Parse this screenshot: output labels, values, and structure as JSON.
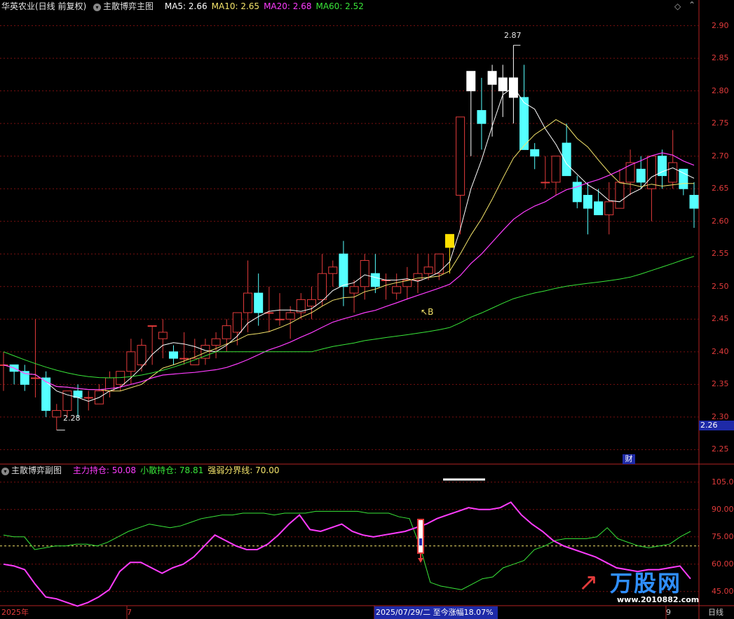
{
  "main_panel": {
    "stock_name": "华英农业(日线 前复权)",
    "indicator_name": "主散博弈主图",
    "ma": [
      {
        "label": "MA5: 2.66",
        "color": "#ffffff"
      },
      {
        "label": "MA10: 2.65",
        "color": "#f5e56b"
      },
      {
        "label": "MA20: 2.68",
        "color": "#ff3cff"
      },
      {
        "label": "MA60: 2.52",
        "color": "#39e639"
      }
    ],
    "y_ticks": [
      "2.90",
      "2.85",
      "2.80",
      "2.75",
      "2.70",
      "2.65",
      "2.60",
      "2.55",
      "2.50",
      "2.45",
      "2.40",
      "2.35",
      "2.30",
      "2.25"
    ],
    "high_label": "2.87",
    "low_label": "2.28",
    "buy_label": "B",
    "current_price": "2.26",
    "fin_badge": "财"
  },
  "sub_panel": {
    "indicator_name": "主散博弈副图",
    "legend": [
      {
        "label": "主力持仓: 50.08",
        "color": "#ff3cff"
      },
      {
        "label": "小散持仓: 78.81",
        "color": "#39e639"
      },
      {
        "label": "强弱分界线: 70.00",
        "color": "#f5e56b"
      }
    ],
    "y_ticks": [
      "105.0",
      "90.00",
      "75.00",
      "60.00",
      "45.00"
    ]
  },
  "bottom_bar": {
    "year_label": "2025年",
    "month_label": "7",
    "date_readout": "2025/07/29/二  至今涨幅18.07%",
    "right_label": "9",
    "period_label": "日线",
    "watermark": "万股网",
    "watermark_url": "www.2010882.com"
  },
  "chart_data": {
    "type": "candlestick",
    "candles": [
      [
        2.38,
        2.4,
        2.34,
        2.38
      ],
      [
        2.38,
        2.38,
        2.35,
        2.37
      ],
      [
        2.37,
        2.38,
        2.34,
        2.35
      ],
      [
        2.36,
        2.45,
        2.33,
        2.36
      ],
      [
        2.36,
        2.37,
        2.3,
        2.31
      ],
      [
        2.3,
        2.32,
        2.28,
        2.31
      ],
      [
        2.31,
        2.34,
        2.3,
        2.34
      ],
      [
        2.34,
        2.35,
        2.3,
        2.33
      ],
      [
        2.33,
        2.34,
        2.31,
        2.33
      ],
      [
        2.32,
        2.35,
        2.32,
        2.34
      ],
      [
        2.34,
        2.37,
        2.33,
        2.36
      ],
      [
        2.35,
        2.37,
        2.34,
        2.37
      ],
      [
        2.37,
        2.42,
        2.35,
        2.4
      ],
      [
        2.38,
        2.42,
        2.37,
        2.41
      ],
      [
        2.44,
        2.44,
        2.38,
        2.44
      ],
      [
        2.42,
        2.45,
        2.39,
        2.43
      ],
      [
        2.4,
        2.41,
        2.38,
        2.39
      ],
      [
        2.39,
        2.43,
        2.38,
        2.39
      ],
      [
        2.38,
        2.42,
        2.38,
        2.39
      ],
      [
        2.39,
        2.42,
        2.38,
        2.41
      ],
      [
        2.41,
        2.43,
        2.39,
        2.42
      ],
      [
        2.42,
        2.45,
        2.4,
        2.44
      ],
      [
        2.43,
        2.46,
        2.41,
        2.46
      ],
      [
        2.46,
        2.54,
        2.43,
        2.49
      ],
      [
        2.49,
        2.52,
        2.44,
        2.46
      ],
      [
        2.46,
        2.5,
        2.43,
        2.46
      ],
      [
        2.45,
        2.49,
        2.44,
        2.45
      ],
      [
        2.45,
        2.47,
        2.42,
        2.46
      ],
      [
        2.46,
        2.49,
        2.45,
        2.48
      ],
      [
        2.47,
        2.5,
        2.45,
        2.48
      ],
      [
        2.48,
        2.55,
        2.47,
        2.52
      ],
      [
        2.52,
        2.54,
        2.5,
        2.53
      ],
      [
        2.55,
        2.57,
        2.47,
        2.5
      ],
      [
        2.49,
        2.51,
        2.46,
        2.5
      ],
      [
        2.5,
        2.55,
        2.48,
        2.54
      ],
      [
        2.52,
        2.55,
        2.49,
        2.5
      ],
      [
        2.51,
        2.52,
        2.48,
        2.51
      ],
      [
        2.49,
        2.52,
        2.48,
        2.5
      ],
      [
        2.5,
        2.53,
        2.48,
        2.51
      ],
      [
        2.51,
        2.55,
        2.49,
        2.52
      ],
      [
        2.52,
        2.55,
        2.51,
        2.53
      ],
      [
        2.52,
        2.55,
        2.51,
        2.55
      ],
      [
        2.56,
        2.57,
        2.52,
        2.58
      ],
      [
        2.64,
        2.76,
        2.58,
        2.76
      ],
      [
        2.8,
        2.83,
        2.7,
        2.83
      ],
      [
        2.77,
        2.82,
        2.71,
        2.75
      ],
      [
        2.83,
        2.84,
        2.73,
        2.81
      ],
      [
        2.8,
        2.84,
        2.76,
        2.82
      ],
      [
        2.79,
        2.87,
        2.75,
        2.82
      ],
      [
        2.79,
        2.84,
        2.71,
        2.71
      ],
      [
        2.71,
        2.72,
        2.68,
        2.7
      ],
      [
        2.66,
        2.7,
        2.65,
        2.66
      ],
      [
        2.66,
        2.69,
        2.64,
        2.7
      ],
      [
        2.72,
        2.75,
        2.67,
        2.67
      ],
      [
        2.66,
        2.67,
        2.62,
        2.63
      ],
      [
        2.64,
        2.66,
        2.58,
        2.62
      ],
      [
        2.63,
        2.65,
        2.61,
        2.61
      ],
      [
        2.61,
        2.66,
        2.58,
        2.63
      ],
      [
        2.62,
        2.68,
        2.62,
        2.66
      ],
      [
        2.66,
        2.71,
        2.64,
        2.69
      ],
      [
        2.68,
        2.7,
        2.65,
        2.66
      ],
      [
        2.65,
        2.7,
        2.6,
        2.7
      ],
      [
        2.7,
        2.71,
        2.65,
        2.67
      ],
      [
        2.66,
        2.74,
        2.65,
        2.69
      ],
      [
        2.68,
        2.68,
        2.64,
        2.65
      ],
      [
        2.64,
        2.66,
        2.59,
        2.62
      ]
    ],
    "sub_series": [
      {
        "name": "主力持仓",
        "color": "#ff3cff",
        "values": [
          60,
          59,
          57,
          49,
          42,
          41,
          39,
          37,
          39,
          42,
          46,
          56,
          61,
          61,
          58,
          55,
          58,
          60,
          64,
          70,
          76,
          73,
          70,
          68,
          68,
          71,
          76,
          82,
          87,
          79,
          78,
          80,
          82,
          78,
          76,
          75,
          76,
          77,
          78,
          80,
          82,
          85,
          87,
          89,
          91,
          90,
          90,
          91,
          94,
          87,
          82,
          78,
          73,
          70,
          68,
          66,
          64,
          61,
          58,
          57,
          56,
          57,
          57,
          58,
          59,
          52
        ]
      },
      {
        "name": "小散持仓",
        "color": "#39e639",
        "values": [
          76,
          75,
          75,
          68,
          69,
          70,
          70,
          71,
          71,
          70,
          72,
          75,
          78,
          80,
          82,
          81,
          80,
          81,
          83,
          85,
          86,
          87,
          87,
          88,
          88,
          88,
          87,
          88,
          88,
          88,
          89,
          89,
          89,
          89,
          89,
          88,
          88,
          88,
          86,
          85,
          70,
          50,
          48,
          47,
          46,
          49,
          52,
          53,
          58,
          60,
          62,
          68,
          70,
          73,
          74,
          74,
          74,
          75,
          80,
          74,
          72,
          70,
          69,
          70,
          71,
          75,
          78
        ]
      },
      {
        "name": "强弱分界线",
        "color": "#f5e56b",
        "values": [
          70
        ]
      }
    ],
    "ylim_main": [
      2.23,
      2.92
    ],
    "ylim_sub": [
      38,
      108
    ]
  }
}
